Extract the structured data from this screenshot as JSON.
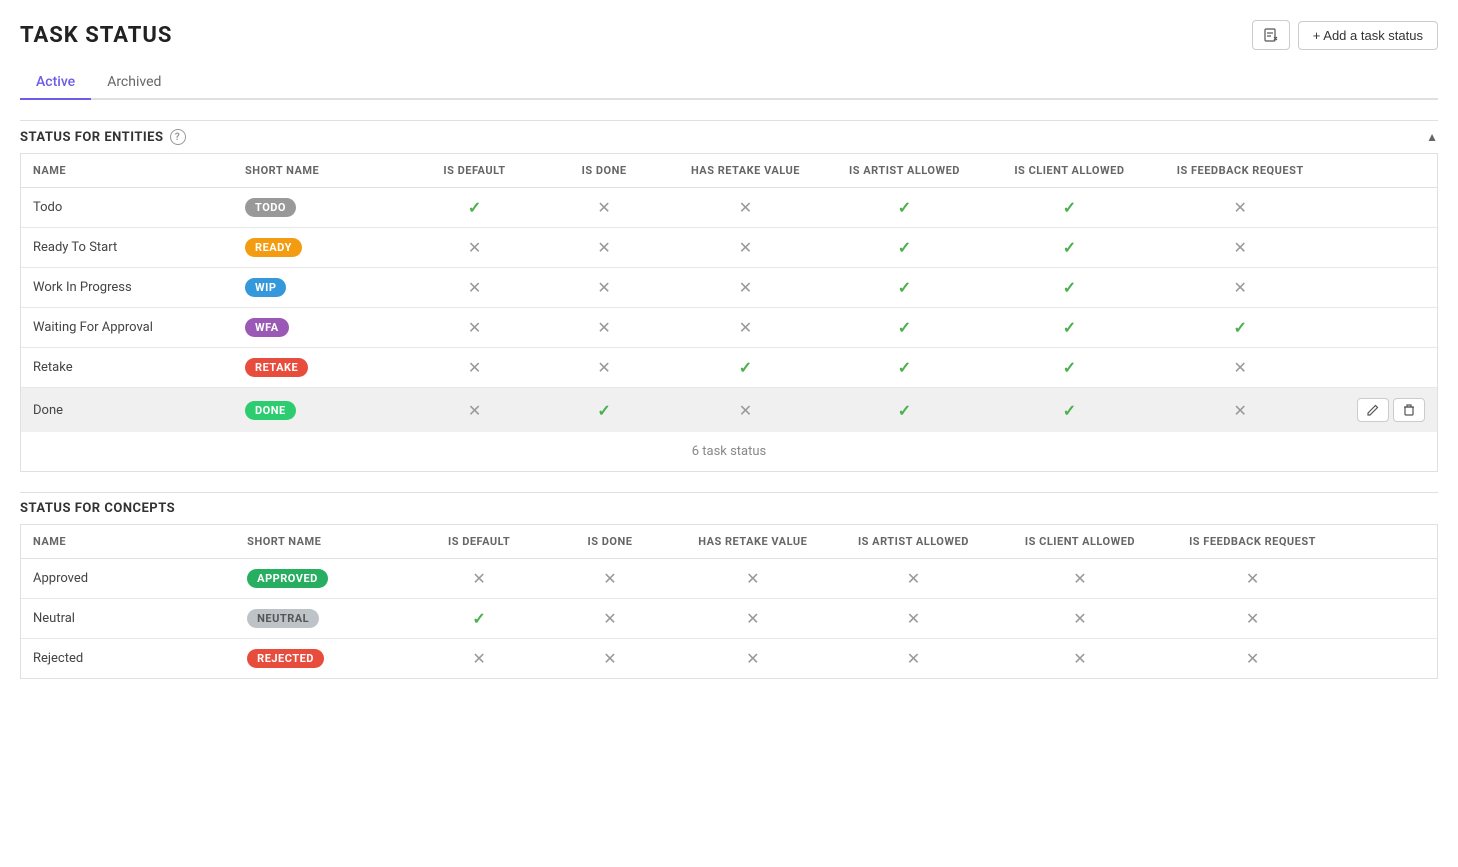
{
  "page": {
    "title": "TASK STATUS",
    "add_button": "+ Add a task status",
    "export_icon": "export"
  },
  "tabs": [
    {
      "id": "active",
      "label": "Active",
      "active": true
    },
    {
      "id": "archived",
      "label": "Archived",
      "active": false
    }
  ],
  "entities_section": {
    "title": "STATUS FOR ENTITIES",
    "count_text": "6 task status",
    "columns": [
      {
        "id": "name",
        "label": "NAME"
      },
      {
        "id": "short_name",
        "label": "SHORT NAME"
      },
      {
        "id": "is_default",
        "label": "IS DEFAULT"
      },
      {
        "id": "is_done",
        "label": "IS DONE"
      },
      {
        "id": "has_retake_value",
        "label": "HAS RETAKE VALUE"
      },
      {
        "id": "is_artist_allowed",
        "label": "IS ARTIST ALLOWED"
      },
      {
        "id": "is_client_allowed",
        "label": "IS CLIENT ALLOWED"
      },
      {
        "id": "is_feedback_request",
        "label": "IS FEEDBACK REQUEST"
      }
    ],
    "rows": [
      {
        "name": "Todo",
        "short_name": "TODO",
        "badge_color": "gray",
        "is_default": true,
        "is_done": false,
        "has_retake_value": false,
        "is_artist_allowed": true,
        "is_client_allowed": true,
        "is_feedback_request": false,
        "highlighted": false
      },
      {
        "name": "Ready To Start",
        "short_name": "READY",
        "badge_color": "yellow",
        "is_default": false,
        "is_done": false,
        "has_retake_value": false,
        "is_artist_allowed": true,
        "is_client_allowed": true,
        "is_feedback_request": false,
        "highlighted": false
      },
      {
        "name": "Work In Progress",
        "short_name": "WIP",
        "badge_color": "blue",
        "is_default": false,
        "is_done": false,
        "has_retake_value": false,
        "is_artist_allowed": true,
        "is_client_allowed": true,
        "is_feedback_request": false,
        "highlighted": false
      },
      {
        "name": "Waiting For Approval",
        "short_name": "WFA",
        "badge_color": "purple",
        "is_default": false,
        "is_done": false,
        "has_retake_value": false,
        "is_artist_allowed": true,
        "is_client_allowed": true,
        "is_feedback_request": true,
        "highlighted": false
      },
      {
        "name": "Retake",
        "short_name": "RETAKE",
        "badge_color": "red",
        "is_default": false,
        "is_done": false,
        "has_retake_value": true,
        "is_artist_allowed": true,
        "is_client_allowed": true,
        "is_feedback_request": false,
        "highlighted": false
      },
      {
        "name": "Done",
        "short_name": "DONE",
        "badge_color": "green",
        "is_default": false,
        "is_done": true,
        "has_retake_value": false,
        "is_artist_allowed": true,
        "is_client_allowed": true,
        "is_feedback_request": false,
        "highlighted": true
      }
    ]
  },
  "concepts_section": {
    "title": "STATUS FOR CONCEPTS",
    "columns": [
      {
        "id": "name",
        "label": "NAME"
      },
      {
        "id": "short_name",
        "label": "SHORT NAME"
      },
      {
        "id": "is_default",
        "label": "IS DEFAULT"
      },
      {
        "id": "is_done",
        "label": "IS DONE"
      },
      {
        "id": "has_retake_value",
        "label": "HAS RETAKE VALUE"
      },
      {
        "id": "is_artist_allowed",
        "label": "IS ARTIST ALLOWED"
      },
      {
        "id": "is_client_allowed",
        "label": "IS CLIENT ALLOWED"
      },
      {
        "id": "is_feedback_request",
        "label": "IS FEEDBACK REQUEST"
      }
    ],
    "rows": [
      {
        "name": "Approved",
        "short_name": "APPROVED",
        "badge_color": "dark-green",
        "is_default": false,
        "is_done": false,
        "has_retake_value": false,
        "is_artist_allowed": false,
        "is_client_allowed": false,
        "is_feedback_request": false,
        "highlighted": false
      },
      {
        "name": "Neutral",
        "short_name": "NEUTRAL",
        "badge_color": "light-gray",
        "is_default": true,
        "is_done": false,
        "has_retake_value": false,
        "is_artist_allowed": false,
        "is_client_allowed": false,
        "is_feedback_request": false,
        "highlighted": false
      },
      {
        "name": "Rejected",
        "short_name": "REJECTED",
        "badge_color": "red",
        "is_default": false,
        "is_done": false,
        "has_retake_value": false,
        "is_artist_allowed": false,
        "is_client_allowed": false,
        "is_feedback_request": false,
        "highlighted": false
      }
    ]
  }
}
